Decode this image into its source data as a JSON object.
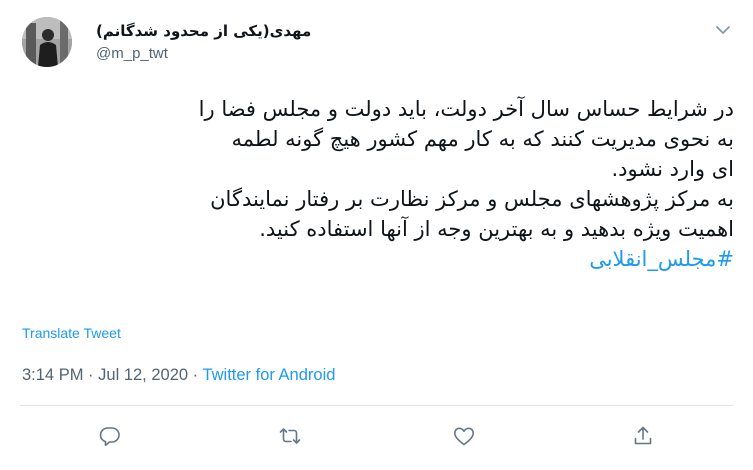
{
  "tweet": {
    "author": {
      "display_name": "مهدی(یکی از محدود شدگانم)",
      "handle": "@m_p_twt"
    },
    "body_lines": [
      "در شرایط حساس سال آخر دولت، باید دولت و مجلس فضا را",
      "به نحوی مدیریت کنند که به کار مهم کشور هیچ گونه لطمه",
      "ای وارد نشود.",
      "به مرکز پژوهشهای مجلس و مرکز نظارت بر رفتار نمایندگان",
      "اهمیت ویژه بدهید و به بهترین وجه از آنها استفاده کنید."
    ],
    "hashtag": "#مجلس_انقلابی",
    "translate_label": "Translate Tweet",
    "time": "3:14 PM",
    "separator": "·",
    "date": "Jul 12, 2020",
    "source": "Twitter for Android"
  },
  "icons": {
    "more": "chevron-down-icon",
    "reply": "reply-icon",
    "retweet": "retweet-icon",
    "like": "like-icon",
    "share": "share-icon"
  },
  "colors": {
    "accent": "#1d9bf0",
    "text": "#0f1419",
    "muted": "#536471",
    "icon": "#657786",
    "divider": "#dfe3e6"
  }
}
